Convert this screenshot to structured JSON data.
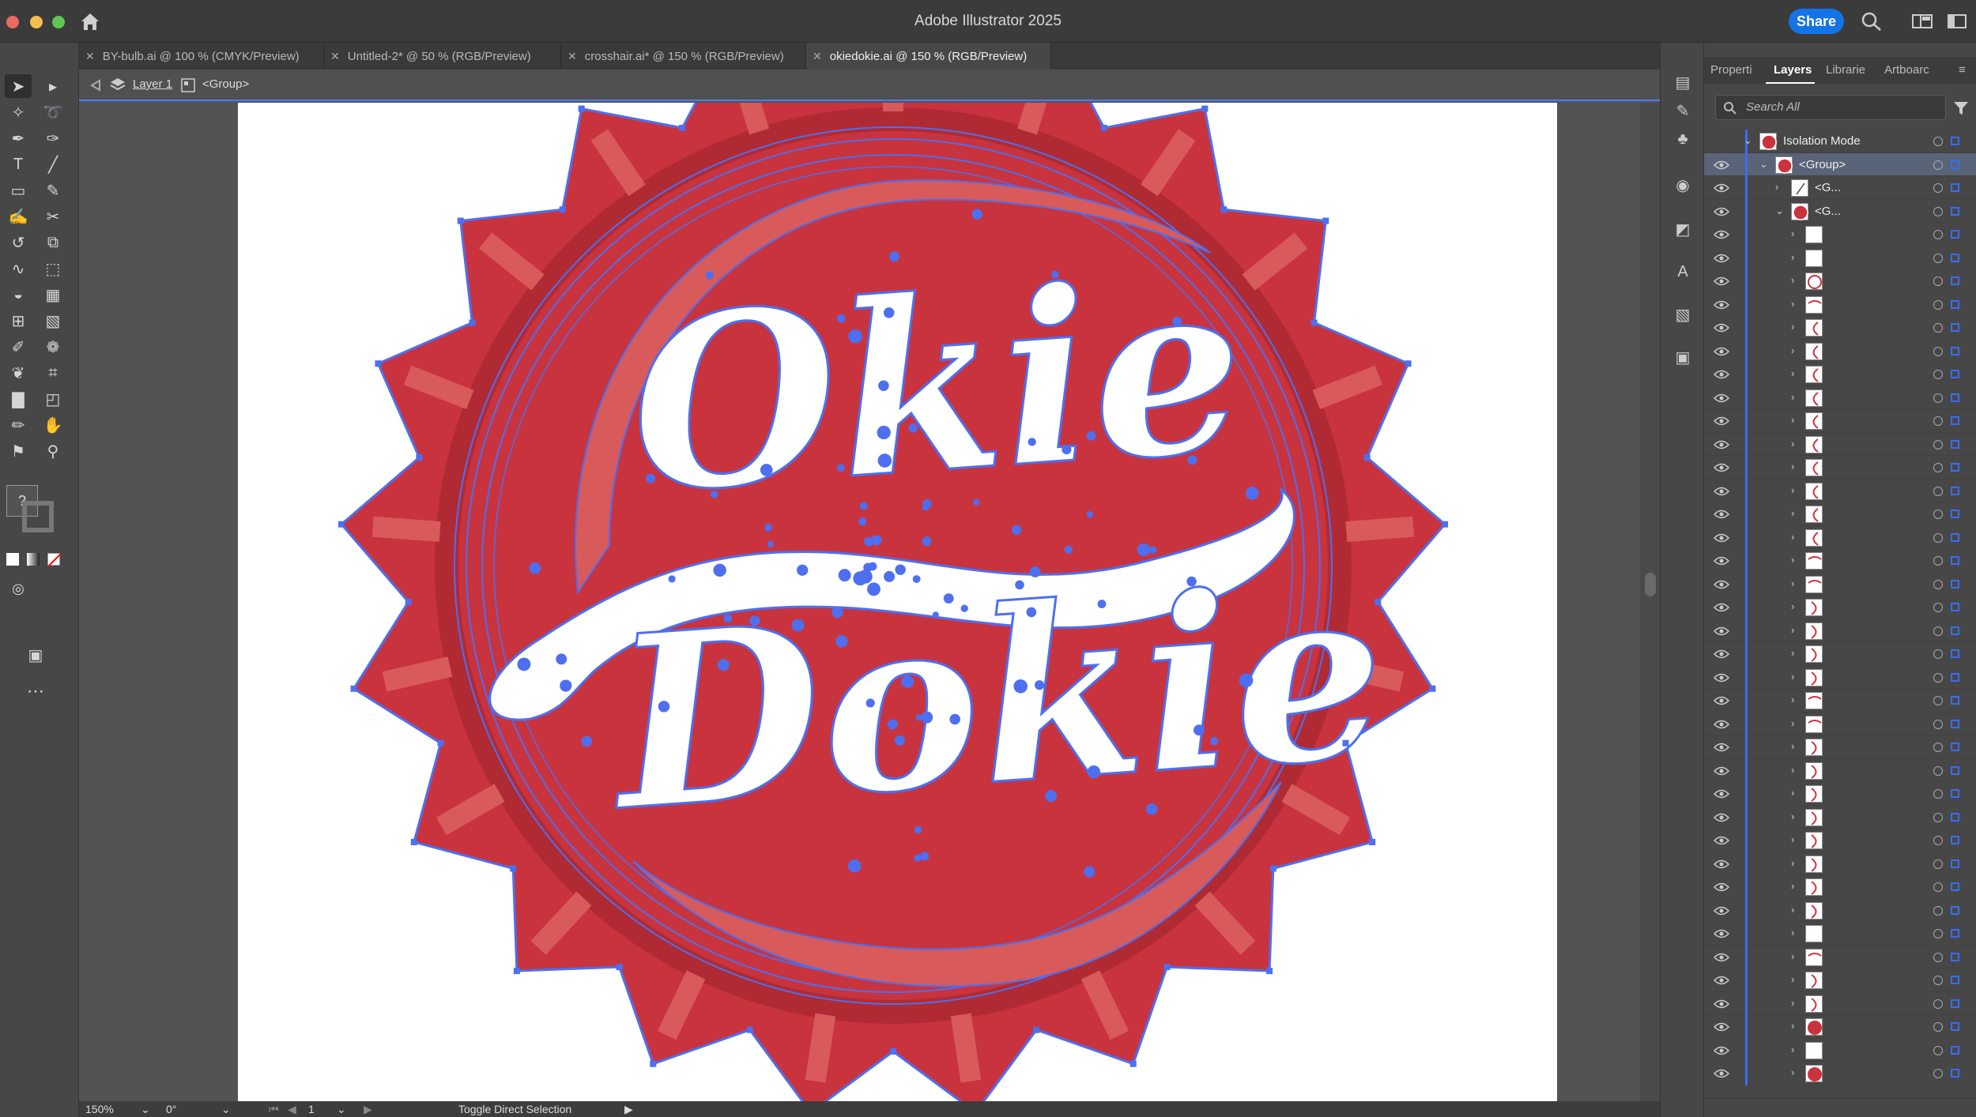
{
  "app": {
    "title": "Adobe Illustrator 2025",
    "share_label": "Share"
  },
  "tabs": [
    {
      "label": "BY-bulb.ai @ 100 % (CMYK/Preview)",
      "active": false
    },
    {
      "label": "Untitled-2* @ 50 % (RGB/Preview)",
      "active": false
    },
    {
      "label": "crosshair.ai* @ 150 % (RGB/Preview)",
      "active": false
    },
    {
      "label": "okiedokie.ai @ 150 % (RGB/Preview)",
      "active": true
    }
  ],
  "breadcrumb": {
    "layer": "Layer 1",
    "group": "<Group>"
  },
  "artwork": {
    "line1": "Okie",
    "line2": "Dokie",
    "cap_color": "#c9333d",
    "stripe_color": "#d95a5a",
    "anchor_color": "#4d6ff0"
  },
  "status": {
    "zoom": "150%",
    "rotation": "0°",
    "artboard": "1",
    "tool_hint": "Toggle Direct Selection"
  },
  "toolbar": {
    "unknown_fill": "?"
  },
  "panel": {
    "tabs": [
      "Properti",
      "Layers",
      "Librarie",
      "Artboarc"
    ],
    "active_tab": "Layers",
    "search_placeholder": "Search All",
    "rows": [
      {
        "label": "Isolation Mode",
        "level": 0,
        "expanded": true,
        "thumb": "cap"
      },
      {
        "label": "<Group>",
        "level": 1,
        "expanded": true,
        "thumb": "cap",
        "selected": true
      },
      {
        "label": "<G...",
        "level": 2,
        "expanded": false,
        "thumb": "slash"
      },
      {
        "label": "<G...",
        "level": 2,
        "expanded": true,
        "thumb": "cap"
      }
    ],
    "child_thumbs": [
      "blank",
      "blank",
      "ring",
      "arc",
      "c",
      "c",
      "c",
      "c",
      "c",
      "c",
      "c",
      "c",
      "c",
      "c",
      "arc",
      "arc",
      "d",
      "d",
      "d",
      "d",
      "arc",
      "arc",
      "d",
      "d",
      "d",
      "d",
      "d",
      "d",
      "d",
      "d",
      "blank",
      "arc",
      "d",
      "d",
      "disc",
      "blank",
      "disc"
    ]
  }
}
